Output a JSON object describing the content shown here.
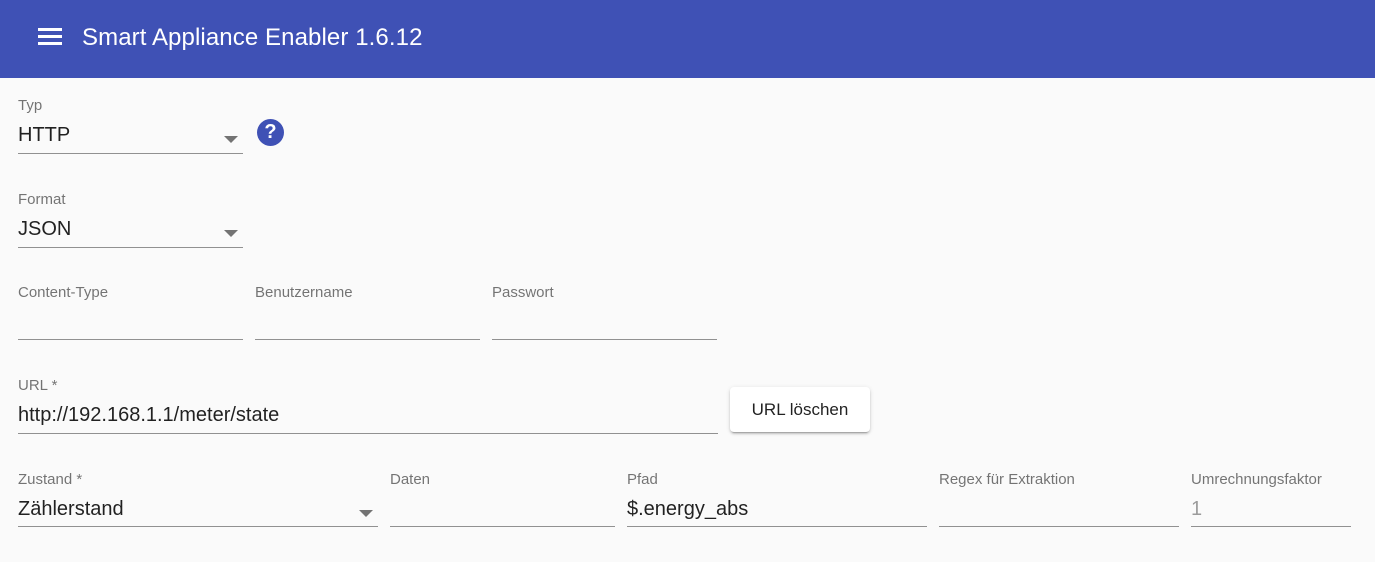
{
  "header": {
    "title": "Smart Appliance Enabler 1.6.12",
    "menu_icon": "menu-icon"
  },
  "form": {
    "typ": {
      "label": "Typ",
      "value": "HTTP"
    },
    "help_icon": {
      "glyph": "?",
      "icon": "help-circle-icon"
    },
    "format": {
      "label": "Format",
      "value": "JSON"
    },
    "content_type": {
      "label": "Content-Type",
      "value": ""
    },
    "benutzername": {
      "label": "Benutzername",
      "value": ""
    },
    "passwort": {
      "label": "Passwort",
      "value": ""
    },
    "url": {
      "label": "URL *",
      "value": "http://192.168.1.1/meter/state"
    },
    "url_clear_button": {
      "label": "URL löschen"
    },
    "zustand": {
      "label": "Zustand *",
      "value": "Zählerstand"
    },
    "daten": {
      "label": "Daten",
      "value": ""
    },
    "pfad": {
      "label": "Pfad",
      "value": "$.energy_abs"
    },
    "regex": {
      "label": "Regex für Extraktion",
      "value": ""
    },
    "umrechnungsfaktor": {
      "label": "Umrechnungsfaktor",
      "value": "1"
    }
  },
  "colors": {
    "primary": "#3f51b5",
    "background": "#fafafa"
  }
}
